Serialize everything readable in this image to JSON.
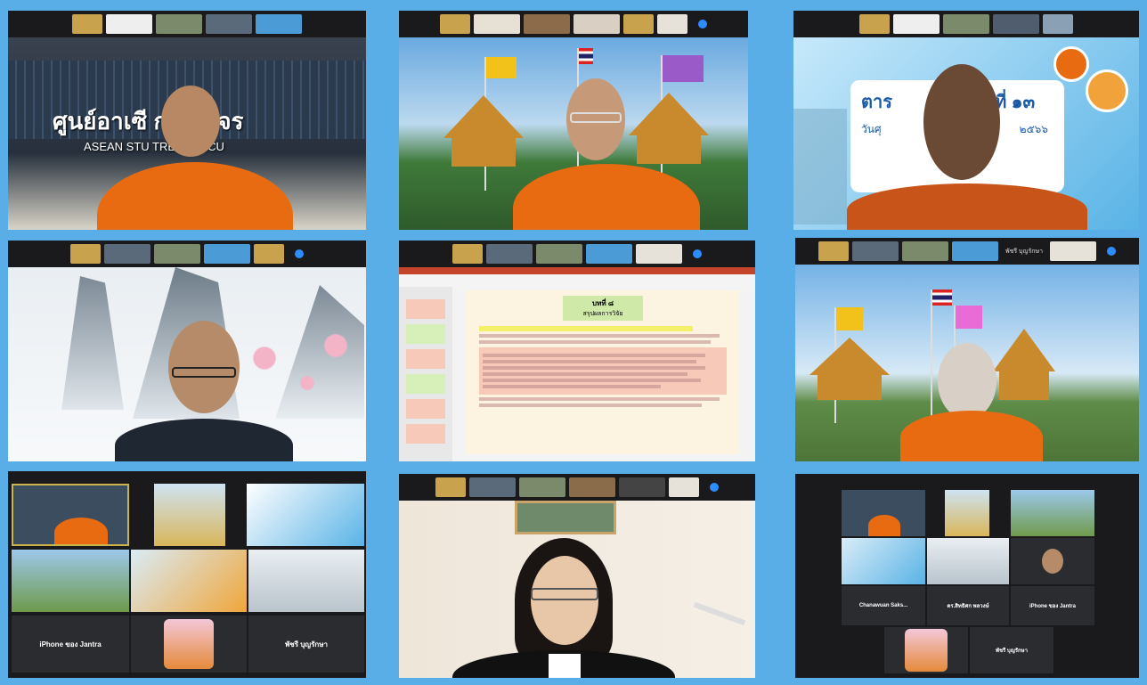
{
  "tile1": {
    "building_sign_th": "ศูนย์อาเซี      กษา มจร",
    "building_sign_en": "ASEAN STU         TRE OF MCU"
  },
  "tile3": {
    "slide_title": "ตาร",
    "slide_number": "ที่ ๑๓",
    "slide_date_prefix": "วันศุ",
    "slide_year": "๒๕๖๖"
  },
  "tile5": {
    "slide_heading": "บทที่ ๘",
    "slide_subheading": "สรุปผลการวิจัย"
  },
  "tile6": {
    "strip_name": "พัชรี บุญรักษา"
  },
  "tile7": {
    "labels": [
      "iPhone ของ Jantra",
      "พัชรี บุญรักษา"
    ]
  },
  "tile9": {
    "labels": [
      "Chanawuan Saks...",
      "ดร.สิทธิศก พลวงษ์",
      "iPhone ของ Jantra",
      "พัชรี บุญรักษา"
    ]
  },
  "colors": {
    "background": "#5aaee8",
    "robe": "#e86b12",
    "tile_bg": "#1e1f22",
    "zoom_blue": "#2d8cff"
  }
}
